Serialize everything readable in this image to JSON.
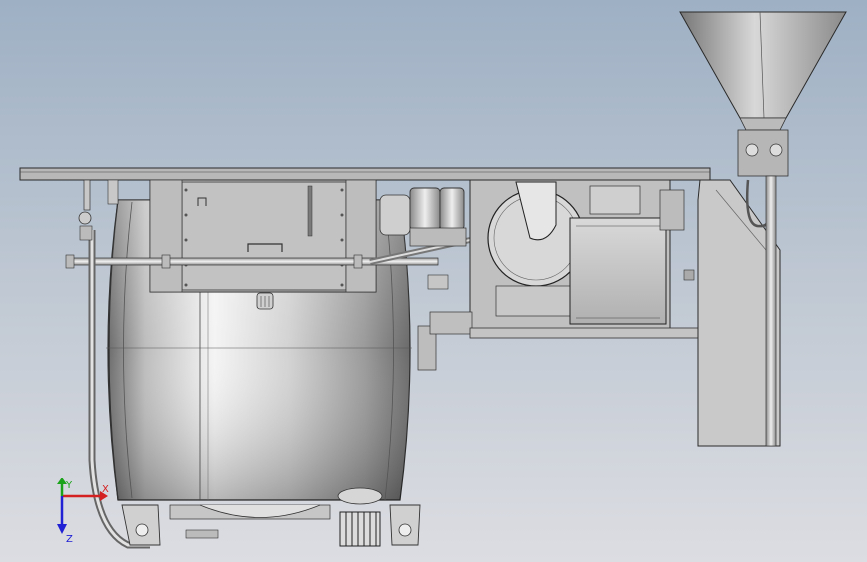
{
  "viewport": {
    "background_top": "#9eb0c4",
    "background_bottom": "#dcdde2",
    "content": "cad-assembly-model-side-view"
  },
  "triad": {
    "x_label": "X",
    "y_label": "Y",
    "z_label": "Z",
    "x_color": "#d42020",
    "y_color": "#1aa31a",
    "z_color": "#2020d4"
  }
}
